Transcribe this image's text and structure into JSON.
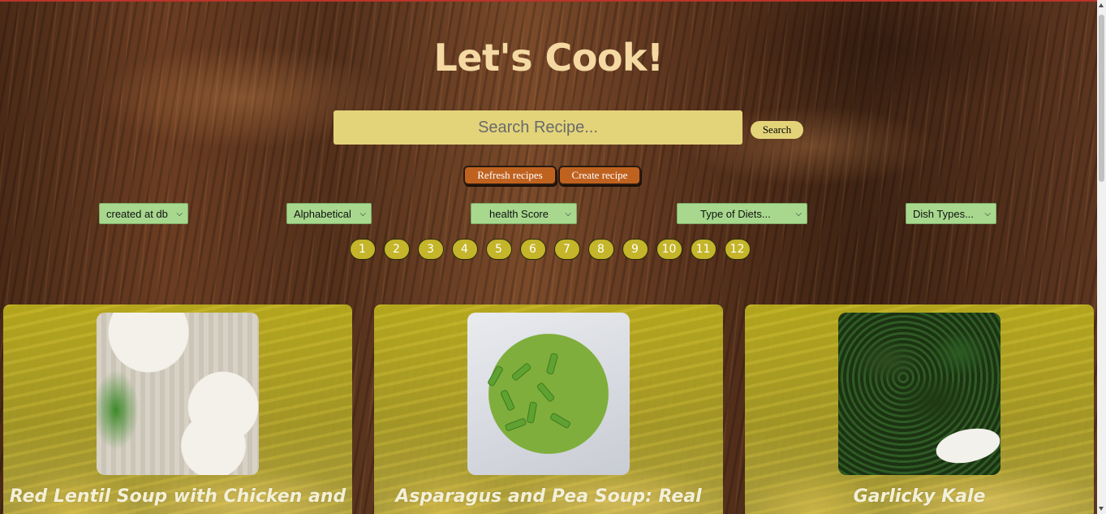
{
  "header": {
    "title": "Let's Cook!"
  },
  "search": {
    "placeholder": "Search Recipe...",
    "button_label": "Search"
  },
  "actions": {
    "refresh_label": "Refresh recipes",
    "create_label": "Create recipe"
  },
  "filters": [
    {
      "selected": "created at db"
    },
    {
      "selected": "Alphabetical"
    },
    {
      "selected": "health Score"
    },
    {
      "selected": "Type of Diets..."
    },
    {
      "selected": "Dish Types..."
    }
  ],
  "pagination": {
    "pages": [
      "1",
      "2",
      "3",
      "4",
      "5",
      "6",
      "7",
      "8",
      "9",
      "10",
      "11",
      "12"
    ]
  },
  "recipes": [
    {
      "title": "Red Lentil Soup with Chicken and",
      "image": "lentil-soup-image"
    },
    {
      "title": "Asparagus and Pea Soup: Real",
      "image": "pea-soup-image"
    },
    {
      "title": "Garlicky Kale",
      "image": "kale-image"
    }
  ],
  "colors": {
    "title": "#f5d9a3",
    "search_bg": "#e3d47a",
    "action_button": "#c0621f",
    "select_bg": "#a8d88e",
    "page_button": "#c4b52a",
    "card_bg": "#bcb01e"
  }
}
